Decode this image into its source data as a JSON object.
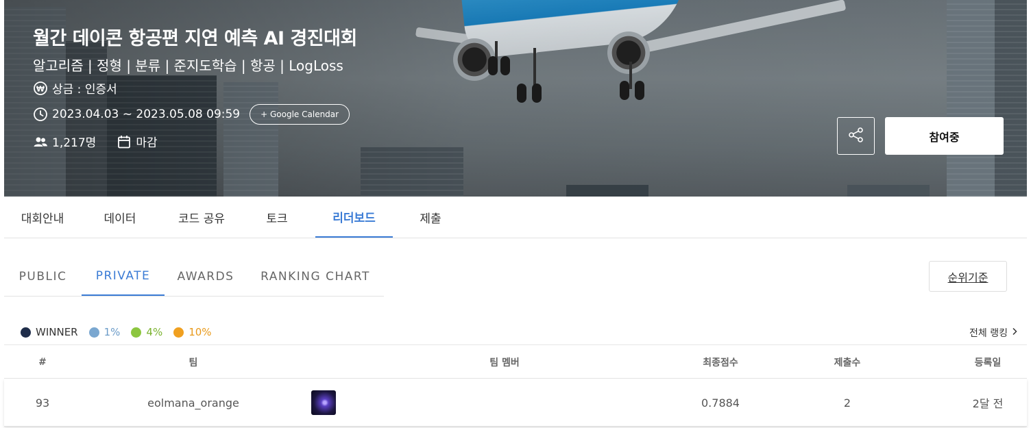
{
  "hero": {
    "title": "월간 데이콘 항공편 지연 예측 AI 경진대회",
    "tags": "알고리즘 | 정형 | 분류 | 준지도학습 | 항공 | LogLoss",
    "prize": "상금 : 인증서",
    "period": "2023.04.03 ~ 2023.05.08 09:59",
    "google_calendar_label": "+ Google Calendar",
    "participants": "1,217명",
    "status": "마감",
    "join_label": "참여중"
  },
  "main_tabs": [
    {
      "label": "대회안내",
      "active": false
    },
    {
      "label": "데이터",
      "active": false
    },
    {
      "label": "코드 공유",
      "active": false
    },
    {
      "label": "토크",
      "active": false
    },
    {
      "label": "리더보드",
      "active": true
    },
    {
      "label": "제출",
      "active": false
    }
  ],
  "sub_tabs": [
    {
      "label": "PUBLIC",
      "active": false
    },
    {
      "label": "PRIVATE",
      "active": true
    },
    {
      "label": "AWARDS",
      "active": false
    },
    {
      "label": "RANKING CHART",
      "active": false
    }
  ],
  "rank_basis_label": "순위기준",
  "legend": [
    {
      "label": "WINNER",
      "color": "#1f2d4a"
    },
    {
      "label": "1%",
      "color": "#7aa7d0"
    },
    {
      "label": "4%",
      "color": "#8cc63f"
    },
    {
      "label": "10%",
      "color": "#f0a020"
    }
  ],
  "full_ranking_label": "전체 랭킹",
  "table": {
    "headers": {
      "rank": "#",
      "team": "팀",
      "members": "팀 멤버",
      "score": "최종점수",
      "submissions": "제출수",
      "registered": "등록일"
    },
    "rows": [
      {
        "rank": "93",
        "team": "eolmana_orange",
        "score": "0.7884",
        "submissions": "2",
        "registered": "2달 전"
      }
    ]
  },
  "colors": {
    "accent": "#3a7bd5"
  }
}
